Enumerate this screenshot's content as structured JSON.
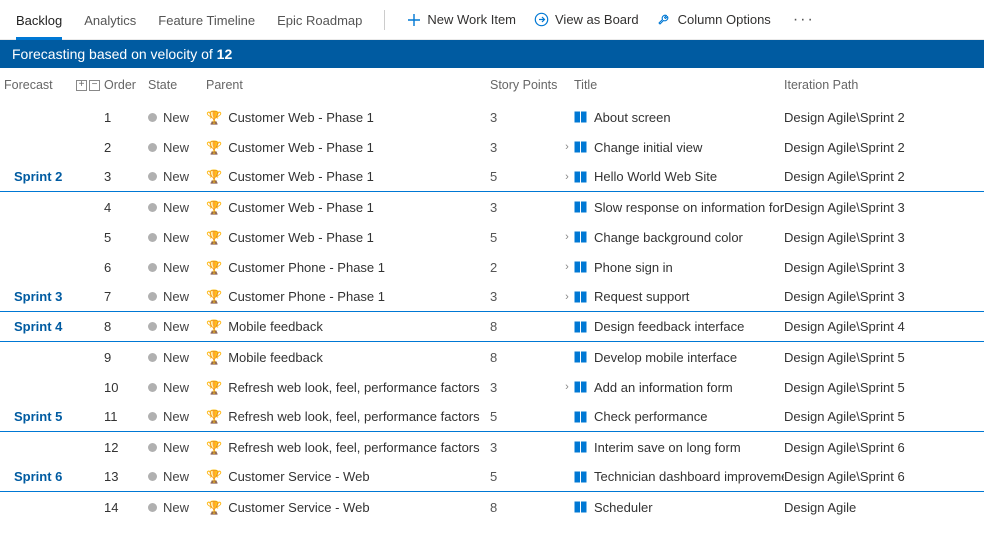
{
  "tabs": [
    "Backlog",
    "Analytics",
    "Feature Timeline",
    "Epic Roadmap"
  ],
  "active_tab": 0,
  "tools": {
    "new_item": "New Work Item",
    "view_board": "View as Board",
    "column_options": "Column Options"
  },
  "banner": {
    "prefix": "Forecasting based on velocity of ",
    "value": "12"
  },
  "columns": {
    "forecast": "Forecast",
    "order": "Order",
    "state": "State",
    "parent": "Parent",
    "story_points": "Story Points",
    "title": "Title",
    "iteration": "Iteration Path"
  },
  "state_label": "New",
  "rows": [
    {
      "forecast": "",
      "order": "1",
      "parent": "Customer Web - Phase 1",
      "sp": "3",
      "exp": false,
      "title": "About screen",
      "iter": "Design Agile\\Sprint 2",
      "border": false
    },
    {
      "forecast": "",
      "order": "2",
      "parent": "Customer Web - Phase 1",
      "sp": "3",
      "exp": true,
      "title": "Change initial view",
      "iter": "Design Agile\\Sprint 2",
      "border": false
    },
    {
      "forecast": "Sprint 2",
      "order": "3",
      "parent": "Customer Web - Phase 1",
      "sp": "5",
      "exp": true,
      "title": "Hello World Web Site",
      "iter": "Design Agile\\Sprint 2",
      "border": true
    },
    {
      "forecast": "",
      "order": "4",
      "parent": "Customer Web - Phase 1",
      "sp": "3",
      "exp": false,
      "title": "Slow response on information form",
      "iter": "Design Agile\\Sprint 3",
      "border": false
    },
    {
      "forecast": "",
      "order": "5",
      "parent": "Customer Web - Phase 1",
      "sp": "5",
      "exp": true,
      "title": "Change background color",
      "iter": "Design Agile\\Sprint 3",
      "border": false
    },
    {
      "forecast": "",
      "order": "6",
      "parent": "Customer Phone - Phase 1",
      "sp": "2",
      "exp": true,
      "title": "Phone sign in",
      "iter": "Design Agile\\Sprint 3",
      "border": false
    },
    {
      "forecast": "Sprint 3",
      "order": "7",
      "parent": "Customer Phone - Phase 1",
      "sp": "3",
      "exp": true,
      "title": "Request support",
      "iter": "Design Agile\\Sprint 3",
      "border": true
    },
    {
      "forecast": "Sprint 4",
      "order": "8",
      "parent": "Mobile feedback",
      "sp": "8",
      "exp": false,
      "title": "Design feedback interface",
      "iter": "Design Agile\\Sprint 4",
      "border": true
    },
    {
      "forecast": "",
      "order": "9",
      "parent": "Mobile feedback",
      "sp": "8",
      "exp": false,
      "title": "Develop mobile interface",
      "iter": "Design Agile\\Sprint 5",
      "border": false
    },
    {
      "forecast": "",
      "order": "10",
      "parent": "Refresh web look, feel, performance factors",
      "sp": "3",
      "exp": true,
      "title": "Add an information form",
      "iter": "Design Agile\\Sprint 5",
      "border": false
    },
    {
      "forecast": "Sprint 5",
      "order": "11",
      "parent": "Refresh web look, feel, performance factors",
      "sp": "5",
      "exp": false,
      "title": "Check performance",
      "iter": "Design Agile\\Sprint 5",
      "border": true
    },
    {
      "forecast": "",
      "order": "12",
      "parent": "Refresh web look, feel, performance factors",
      "sp": "3",
      "exp": false,
      "title": "Interim save on long form",
      "iter": "Design Agile\\Sprint 6",
      "border": false
    },
    {
      "forecast": "Sprint 6",
      "order": "13",
      "parent": "Customer Service - Web",
      "sp": "5",
      "exp": false,
      "title": "Technician dashboard improvements",
      "iter": "Design Agile\\Sprint 6",
      "border": true
    },
    {
      "forecast": "",
      "order": "14",
      "parent": "Customer Service - Web",
      "sp": "8",
      "exp": false,
      "title": "Scheduler",
      "iter": "Design Agile",
      "border": false
    }
  ]
}
